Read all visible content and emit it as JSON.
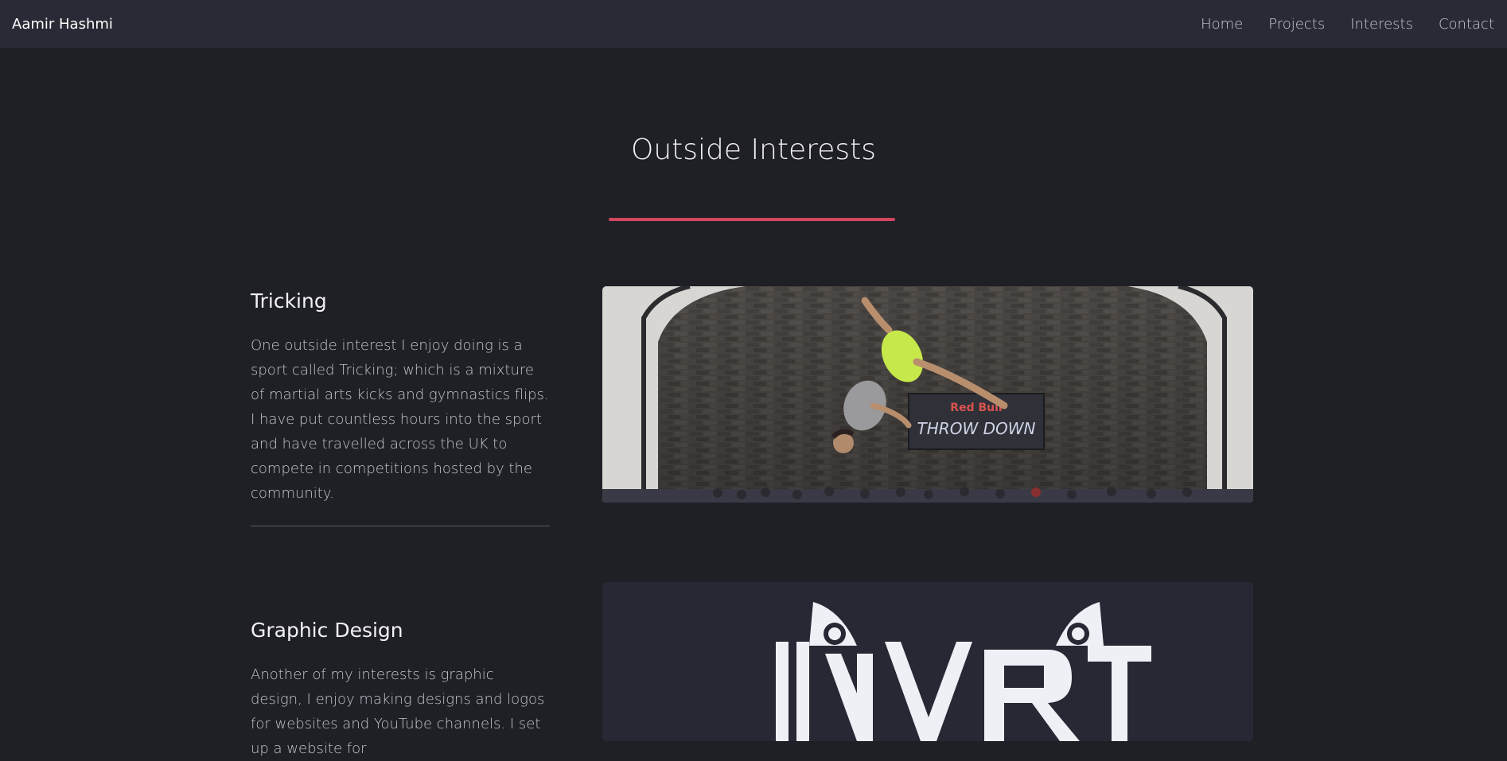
{
  "navbar": {
    "brand": "Aamir Hashmi",
    "links": [
      "Home",
      "Projects",
      "Interests",
      "Contact"
    ]
  },
  "section": {
    "title": "Outside Interests",
    "accent_color": "#d0465f"
  },
  "interests": [
    {
      "heading": "Tricking",
      "body": "One outside interest I enjoy doing is a sport called Tricking; which is a mixture of martial arts kicks and gymnastics flips. I have put countless hours into the sport and have travelled across the UK to compete in competitions hosted by the community.",
      "image_icon": "tricking-photo",
      "banner_logo": "Red Bull",
      "banner_text": "THROW DOWN"
    },
    {
      "heading": "Graphic Design",
      "body": "Another of my interests is graphic design, I enjoy making designs and logos for websites and YouTube channels. I set up a website for",
      "image_icon": "invrt-logo",
      "logo_text": "INVRT"
    }
  ],
  "colors": {
    "background": "#1f1f26",
    "navbar": "#292a35",
    "accent": "#d0465f"
  }
}
